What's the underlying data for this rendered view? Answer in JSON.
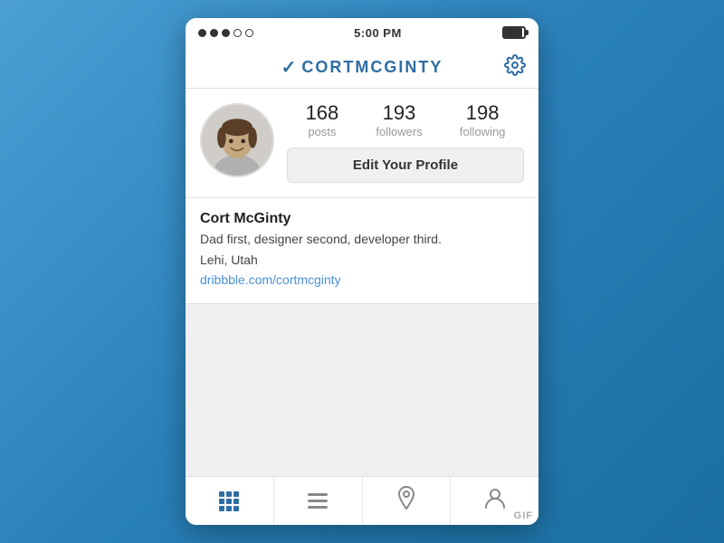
{
  "statusBar": {
    "time": "5:00 PM"
  },
  "topNav": {
    "username": "CORTMCGINTY",
    "chevron": "✓",
    "settingsLabel": "⚙"
  },
  "profile": {
    "stats": [
      {
        "number": "168",
        "label": "posts"
      },
      {
        "number": "193",
        "label": "followers"
      },
      {
        "number": "198",
        "label": "following"
      }
    ],
    "editButtonLabel": "Edit Your Profile"
  },
  "bio": {
    "name": "Cort McGinty",
    "description": "Dad first, designer second, developer third.",
    "location": "Lehi, Utah",
    "link": "dribbble.com/cortmcginty"
  },
  "tabBar": {
    "gifLabel": "GIF"
  }
}
